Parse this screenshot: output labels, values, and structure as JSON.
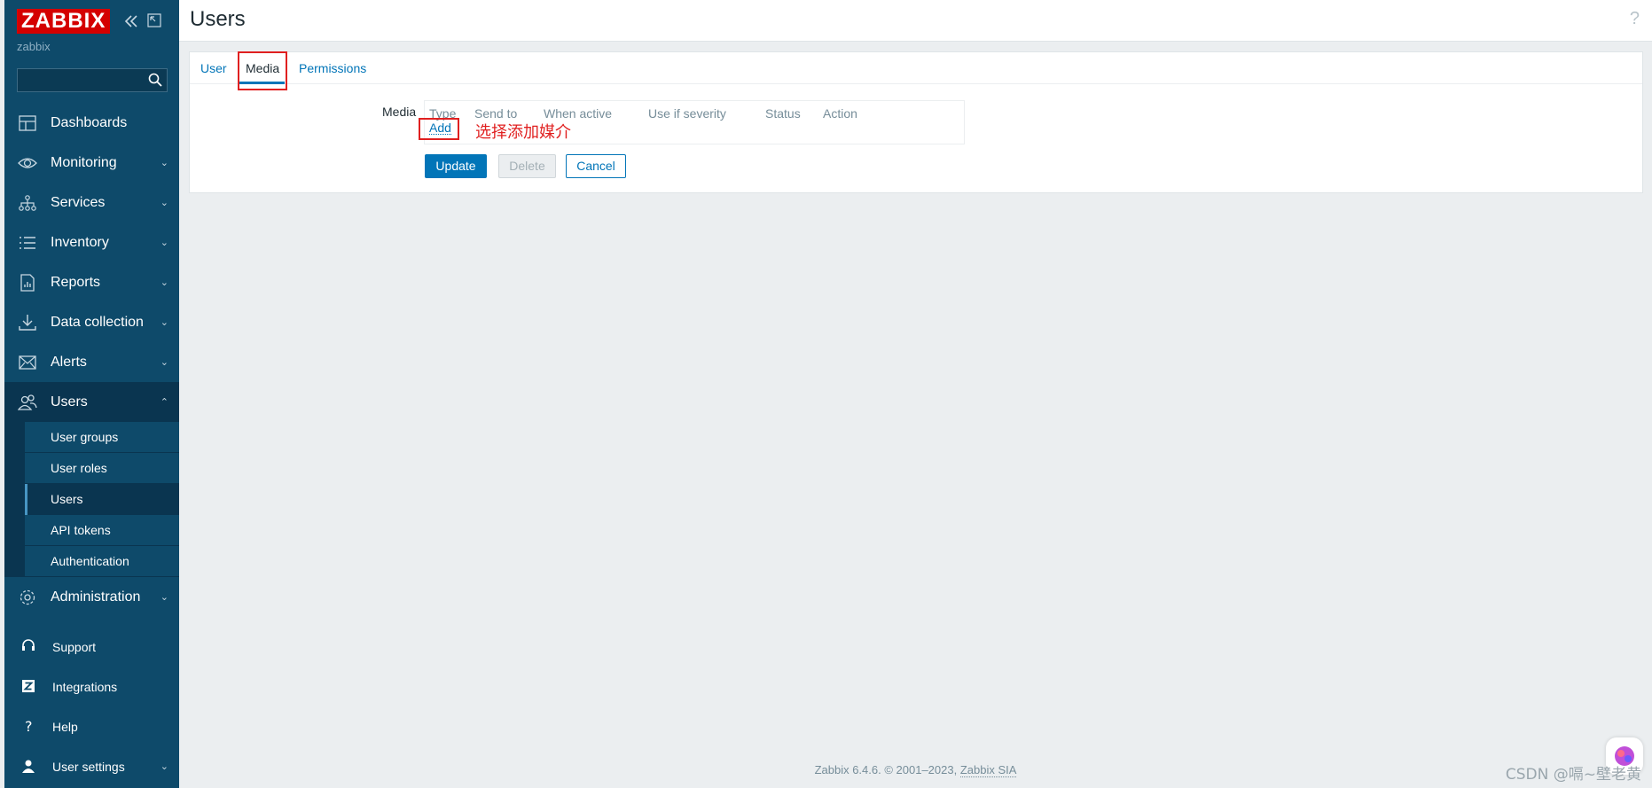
{
  "sidebar": {
    "logo": "ZABBIX",
    "server_name": "zabbix",
    "search": {
      "value": "",
      "placeholder": ""
    },
    "menu": [
      {
        "label": "Dashboards",
        "icon": "dashboards-icon",
        "has_chevron": false
      },
      {
        "label": "Monitoring",
        "icon": "eye-icon",
        "has_chevron": true
      },
      {
        "label": "Services",
        "icon": "services-icon",
        "has_chevron": true
      },
      {
        "label": "Inventory",
        "icon": "list-icon",
        "has_chevron": true
      },
      {
        "label": "Reports",
        "icon": "reports-icon",
        "has_chevron": true
      },
      {
        "label": "Data collection",
        "icon": "download-icon",
        "has_chevron": true
      },
      {
        "label": "Alerts",
        "icon": "envelope-icon",
        "has_chevron": true
      },
      {
        "label": "Users",
        "icon": "users-icon",
        "has_chevron": true,
        "expanded": true
      }
    ],
    "users_submenu": [
      "User groups",
      "User roles",
      "Users",
      "API tokens",
      "Authentication"
    ],
    "administration": "Administration",
    "bottom": [
      "Support",
      "Integrations",
      "Help",
      "User settings"
    ]
  },
  "header": {
    "title": "Users",
    "help": "?"
  },
  "tabs": [
    "User",
    "Media",
    "Permissions"
  ],
  "form": {
    "media_label": "Media",
    "columns": [
      "Type",
      "Send to",
      "When active",
      "Use if severity",
      "Status",
      "Action"
    ],
    "add_link": "Add",
    "annotation": "选择添加媒介",
    "buttons": {
      "update": "Update",
      "delete": "Delete",
      "cancel": "Cancel"
    }
  },
  "footer": {
    "text": "Zabbix 6.4.6. © 2001–2023, ",
    "owner": "Zabbix SIA"
  },
  "watermark": "CSDN @嗝~壁老黄",
  "colors": {
    "sidebar": "#0e4a6a",
    "accent": "#0275b8",
    "annotation": "#e02020"
  }
}
